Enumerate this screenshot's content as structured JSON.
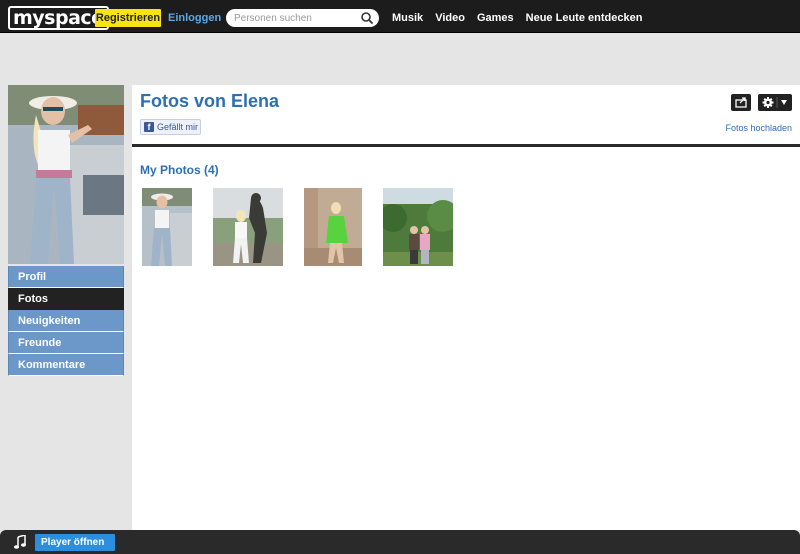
{
  "header": {
    "logo": "myspace",
    "register_label": "Registrieren",
    "login_label": "Einloggen",
    "search_placeholder": "Personen suchen",
    "nav": [
      "Musik",
      "Video",
      "Games",
      "Neue Leute entdecken"
    ]
  },
  "sidebar": {
    "items": [
      {
        "label": "Profil",
        "active": false
      },
      {
        "label": "Fotos",
        "active": true
      },
      {
        "label": "Neuigkeiten",
        "active": false
      },
      {
        "label": "Freunde",
        "active": false
      },
      {
        "label": "Kommentare",
        "active": false
      }
    ]
  },
  "main": {
    "title": "Fotos von Elena",
    "like_label": "Gefällt mir",
    "upload_link": "Fotos hochladen",
    "section_title": "My Photos (4)",
    "photos": [
      {
        "alt": "photo-1"
      },
      {
        "alt": "photo-2"
      },
      {
        "alt": "photo-3"
      },
      {
        "alt": "photo-4"
      }
    ]
  },
  "player": {
    "open_label": "Player öffnen ↗"
  },
  "colors": {
    "accent": "#2d6fb5",
    "register_bg": "#f7e415",
    "sidebar_bg": "#6b97c9",
    "sidebar_active": "#222222",
    "player_btn": "#2b8fe0"
  }
}
